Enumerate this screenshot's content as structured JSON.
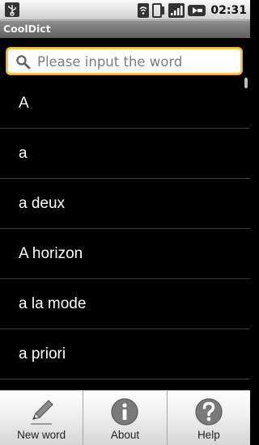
{
  "status_bar": {
    "time": "02:31",
    "icons": [
      "usb-icon",
      "wifi-icon",
      "notification-icon",
      "signal-icon",
      "battery-icon"
    ]
  },
  "app": {
    "title": "CoolDict"
  },
  "search": {
    "placeholder": "Please input the word",
    "value": ""
  },
  "words": [
    {
      "label": "A"
    },
    {
      "label": "a"
    },
    {
      "label": "a deux"
    },
    {
      "label": "A horizon"
    },
    {
      "label": "a la mode"
    },
    {
      "label": "a priori"
    }
  ],
  "menu": [
    {
      "label": "New word",
      "icon": "pencil-icon"
    },
    {
      "label": "About",
      "icon": "info-icon"
    },
    {
      "label": "Help",
      "icon": "help-icon"
    }
  ],
  "colors": {
    "search_focus": "#f6c64b",
    "list_background": "#000000",
    "list_text": "#ffffff"
  }
}
